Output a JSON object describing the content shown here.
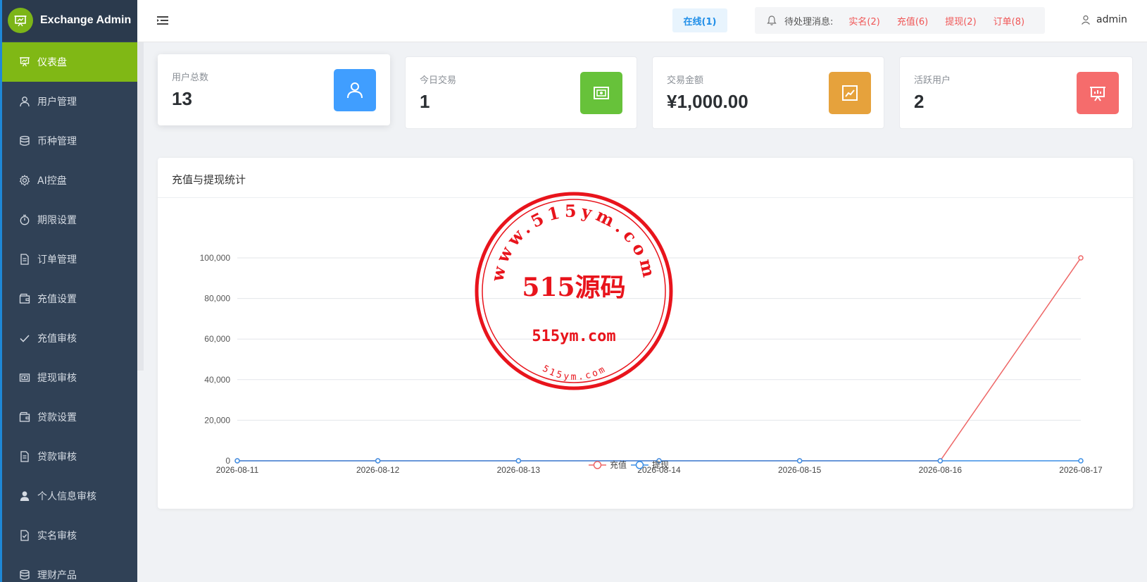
{
  "app": {
    "title": "Exchange Admin"
  },
  "sidebar": {
    "items": [
      {
        "label": "仪表盘",
        "icon": "dashboard-icon",
        "active": true
      },
      {
        "label": "用户管理",
        "icon": "user-icon"
      },
      {
        "label": "币种管理",
        "icon": "database-icon"
      },
      {
        "label": "AI控盘",
        "icon": "gear-icon"
      },
      {
        "label": "期限设置",
        "icon": "stopwatch-icon"
      },
      {
        "label": "订单管理",
        "icon": "document-icon"
      },
      {
        "label": "充值设置",
        "icon": "wallet-icon"
      },
      {
        "label": "充值审核",
        "icon": "check-icon"
      },
      {
        "label": "提现审核",
        "icon": "cash-icon"
      },
      {
        "label": "贷款设置",
        "icon": "wallet-icon"
      },
      {
        "label": "贷款审核",
        "icon": "document-icon"
      },
      {
        "label": "个人信息审核",
        "icon": "person-filled-icon"
      },
      {
        "label": "实名审核",
        "icon": "document-check-icon"
      },
      {
        "label": "理财产品",
        "icon": "database-icon"
      }
    ]
  },
  "header": {
    "online": "在线(1)",
    "pending_label": "待处理消息:",
    "pending": [
      {
        "label": "实名(2)"
      },
      {
        "label": "充值(6)"
      },
      {
        "label": "提现(2)"
      },
      {
        "label": "订单(8)"
      }
    ],
    "user": "admin"
  },
  "stats": [
    {
      "label": "用户总数",
      "value": "13",
      "icon": "user-icon",
      "color": "#409eff"
    },
    {
      "label": "今日交易",
      "value": "1",
      "icon": "cash-icon",
      "color": "#67c23a"
    },
    {
      "label": "交易金额",
      "value": "¥1,000.00",
      "icon": "trend-chart-icon",
      "color": "#e6a23c"
    },
    {
      "label": "活跃用户",
      "value": "2",
      "icon": "presentation-icon",
      "color": "#f56c6c"
    }
  ],
  "panel": {
    "title": "充值与提现统计"
  },
  "chart_data": {
    "type": "line",
    "title": "",
    "xlabel": "",
    "ylabel": "",
    "x": [
      "2026-08-11",
      "2026-08-12",
      "2026-08-13",
      "2026-08-14",
      "2026-08-15",
      "2026-08-16",
      "2026-08-17"
    ],
    "ylim": [
      0,
      100000
    ],
    "yticks": [
      0,
      20000,
      40000,
      60000,
      80000,
      100000
    ],
    "ytick_labels": [
      "0",
      "20,000",
      "40,000",
      "60,000",
      "80,000",
      "100,000"
    ],
    "grid": true,
    "legend": "bottom-center",
    "series": [
      {
        "name": "充值",
        "color": "#ee6666",
        "values": [
          0,
          0,
          0,
          0,
          0,
          0,
          100000
        ]
      },
      {
        "name": "提现",
        "color": "#3a8ee6",
        "values": [
          0,
          0,
          0,
          0,
          0,
          0,
          0
        ]
      }
    ]
  },
  "stamp": {
    "center_text": "515源码",
    "domain_text": "515ym.com",
    "ring_text": "www.515ym.com",
    "small_text": "515ym.com",
    "color": "#e8141c"
  }
}
